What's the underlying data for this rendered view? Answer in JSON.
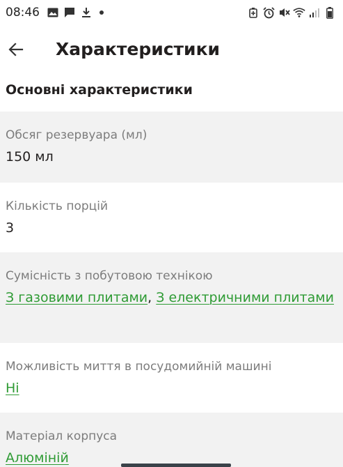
{
  "status_bar": {
    "time": "08:46",
    "left_icons": [
      "image-icon",
      "message-icon",
      "download-icon",
      "dot-icon"
    ],
    "right_icons": [
      "battery-saver-icon",
      "alarm-icon",
      "mute-icon",
      "wifi-icon",
      "signal-icon",
      "battery-icon"
    ]
  },
  "header": {
    "title": "Характеристики"
  },
  "section": {
    "title": "Основні характеристики"
  },
  "specs": [
    {
      "label": "Обсяг резервуара (мл)",
      "value": "150 мл"
    },
    {
      "label": "Кількість порцій",
      "value": "3"
    },
    {
      "label": "Сумісність з побутовою технікою",
      "links": [
        "З газовими плитами",
        "З електричними плитами"
      ],
      "separator": ", "
    },
    {
      "label": "Можливість миття в посудомийній машині",
      "links": [
        "Ні"
      ]
    },
    {
      "label": "Матеріал корпуса",
      "links": [
        "Алюміній"
      ]
    }
  ],
  "colors": {
    "link": "#2e9b34",
    "shade": "#f2f2f2",
    "label": "#7c7c7c",
    "text": "#221f1f"
  }
}
